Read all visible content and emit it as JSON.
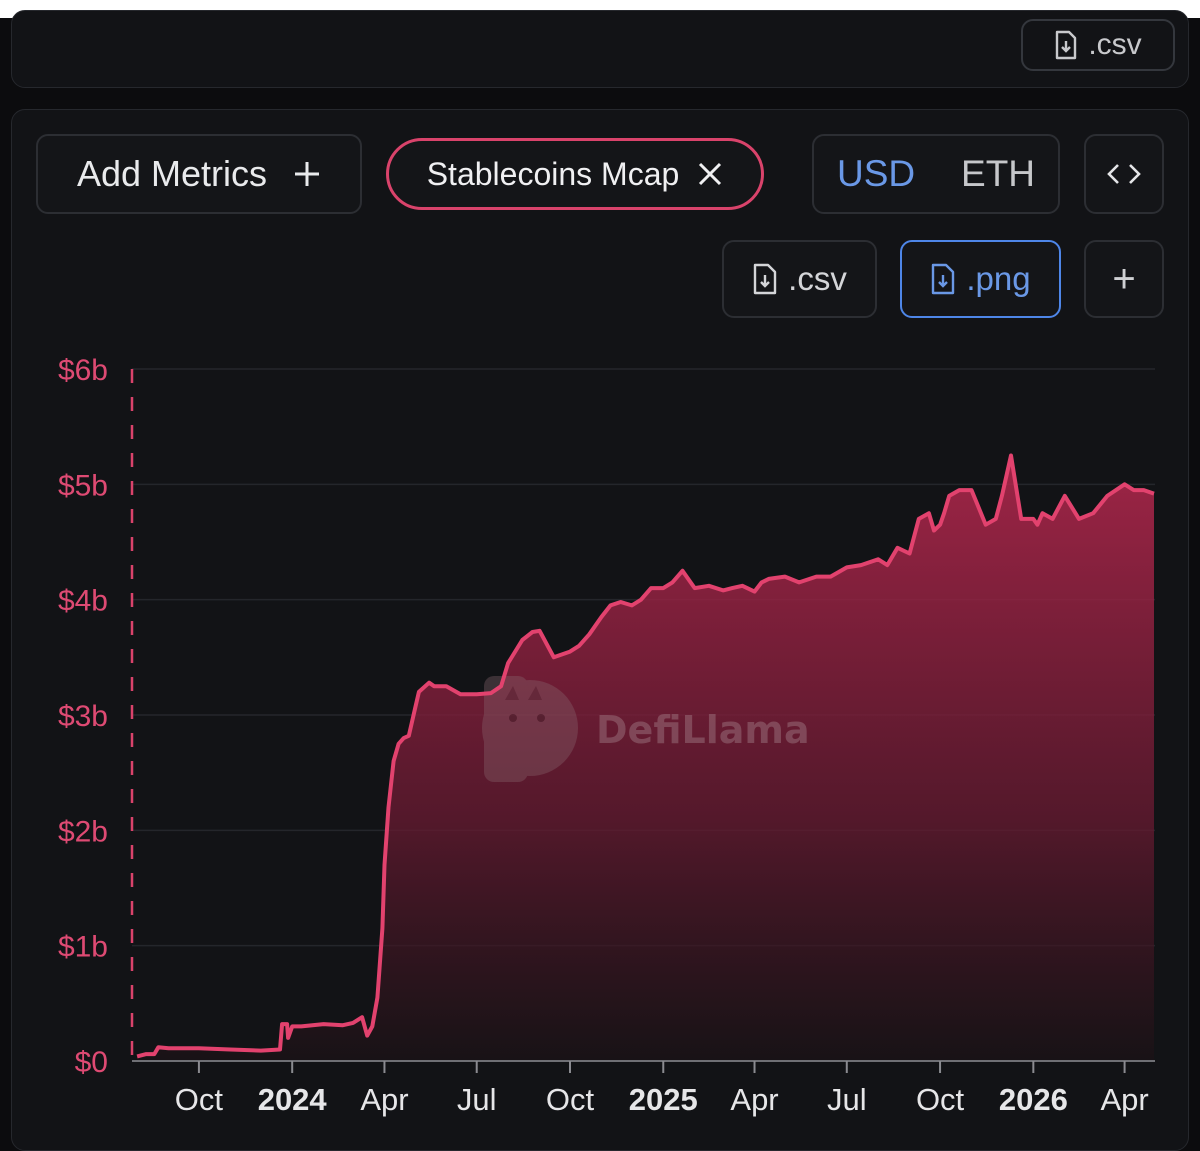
{
  "previous_card": {
    "csv_label": ".csv"
  },
  "toolbar": {
    "add_metrics_label": "Add Metrics",
    "metric_chip_label": "Stablecoins Mcap",
    "currency_usd": "USD",
    "currency_eth": "ETH",
    "embed_label": "<>",
    "csv_label": ".csv",
    "png_label": ".png",
    "plus_label": "+"
  },
  "watermark": "DefiLlama",
  "colors": {
    "accent": "#d9436b",
    "line": "#e2426e",
    "active_currency": "#6a98e6"
  },
  "chart_data": {
    "type": "area",
    "title": "",
    "series": [
      {
        "name": "Stablecoins Mcap",
        "x": [
          "2023-08-01",
          "2023-08-10",
          "2023-08-18",
          "2023-08-22",
          "2023-09-01",
          "2023-10-01",
          "2023-11-01",
          "2023-12-01",
          "2023-12-20",
          "2023-12-22",
          "2023-12-27",
          "2023-12-28",
          "2024-01-01",
          "2024-01-10",
          "2024-02-01",
          "2024-02-20",
          "2024-03-01",
          "2024-03-10",
          "2024-03-15",
          "2024-03-20",
          "2024-03-25",
          "2024-03-30",
          "2024-04-01",
          "2024-04-05",
          "2024-04-10",
          "2024-04-15",
          "2024-04-20",
          "2024-04-25",
          "2024-05-01",
          "2024-05-05",
          "2024-05-15",
          "2024-05-20",
          "2024-06-01",
          "2024-06-15",
          "2024-07-01",
          "2024-07-15",
          "2024-07-25",
          "2024-08-01",
          "2024-08-15",
          "2024-08-25",
          "2024-09-01",
          "2024-09-15",
          "2024-10-01",
          "2024-10-10",
          "2024-10-20",
          "2024-11-01",
          "2024-11-10",
          "2024-11-20",
          "2024-12-01",
          "2024-12-10",
          "2024-12-20",
          "2025-01-01",
          "2025-01-10",
          "2025-01-20",
          "2025-02-01",
          "2025-02-15",
          "2025-03-01",
          "2025-03-10",
          "2025-03-20",
          "2025-04-01",
          "2025-04-08",
          "2025-04-15",
          "2025-05-01",
          "2025-05-15",
          "2025-06-01",
          "2025-06-15",
          "2025-07-01",
          "2025-07-15",
          "2025-08-01",
          "2025-08-10",
          "2025-08-20",
          "2025-09-01",
          "2025-09-10",
          "2025-09-20",
          "2025-09-25",
          "2025-10-01",
          "2025-10-05",
          "2025-10-10",
          "2025-10-20",
          "2025-11-01",
          "2025-11-15",
          "2025-11-25",
          "2025-12-01",
          "2025-12-10",
          "2025-12-20",
          "2026-01-01",
          "2026-01-05",
          "2026-01-10",
          "2026-01-20",
          "2026-02-01",
          "2026-02-15",
          "2026-03-01",
          "2026-03-15",
          "2026-04-01",
          "2026-04-10",
          "2026-04-20",
          "2026-04-30"
        ],
        "values": [
          0.04,
          0.06,
          0.06,
          0.12,
          0.11,
          0.11,
          0.1,
          0.09,
          0.1,
          0.32,
          0.32,
          0.2,
          0.3,
          0.3,
          0.32,
          0.31,
          0.33,
          0.38,
          0.22,
          0.3,
          0.55,
          1.15,
          1.7,
          2.2,
          2.6,
          2.75,
          2.8,
          2.82,
          3.05,
          3.2,
          3.28,
          3.25,
          3.25,
          3.18,
          3.18,
          3.19,
          3.25,
          3.45,
          3.65,
          3.72,
          3.73,
          3.5,
          3.55,
          3.6,
          3.7,
          3.85,
          3.95,
          3.98,
          3.95,
          4.0,
          4.1,
          4.1,
          4.15,
          4.25,
          4.1,
          4.12,
          4.08,
          4.1,
          4.12,
          4.07,
          4.15,
          4.18,
          4.2,
          4.15,
          4.2,
          4.2,
          4.28,
          4.3,
          4.35,
          4.3,
          4.45,
          4.4,
          4.7,
          4.75,
          4.6,
          4.65,
          4.75,
          4.9,
          4.95,
          4.95,
          4.65,
          4.7,
          4.9,
          5.25,
          4.7,
          4.7,
          4.65,
          4.75,
          4.7,
          4.9,
          4.7,
          4.75,
          4.9,
          5.0,
          4.95,
          4.95,
          4.92
        ]
      }
    ],
    "xlabel": "",
    "ylabel": "",
    "ylim": [
      0,
      6
    ],
    "xlim": [
      "2023-07-27",
      "2026-05-01"
    ],
    "yticks": [
      {
        "value": 0,
        "label": "$0"
      },
      {
        "value": 1,
        "label": "$1b"
      },
      {
        "value": 2,
        "label": "$2b"
      },
      {
        "value": 3,
        "label": "$3b"
      },
      {
        "value": 4,
        "label": "$4b"
      },
      {
        "value": 5,
        "label": "$5b"
      },
      {
        "value": 6,
        "label": "$6b"
      }
    ],
    "xticks": [
      {
        "date": "2023-10-01",
        "label": "Oct",
        "year": false
      },
      {
        "date": "2024-01-01",
        "label": "2024",
        "year": true
      },
      {
        "date": "2024-04-01",
        "label": "Apr",
        "year": false
      },
      {
        "date": "2024-07-01",
        "label": "Jul",
        "year": false
      },
      {
        "date": "2024-10-01",
        "label": "Oct",
        "year": false
      },
      {
        "date": "2025-01-01",
        "label": "2025",
        "year": true
      },
      {
        "date": "2025-04-01",
        "label": "Apr",
        "year": false
      },
      {
        "date": "2025-07-01",
        "label": "Jul",
        "year": false
      },
      {
        "date": "2025-10-01",
        "label": "Oct",
        "year": false
      },
      {
        "date": "2026-01-01",
        "label": "2026",
        "year": true
      },
      {
        "date": "2026-04-01",
        "label": "Apr",
        "year": false
      }
    ],
    "grid": true,
    "legend": "none"
  }
}
